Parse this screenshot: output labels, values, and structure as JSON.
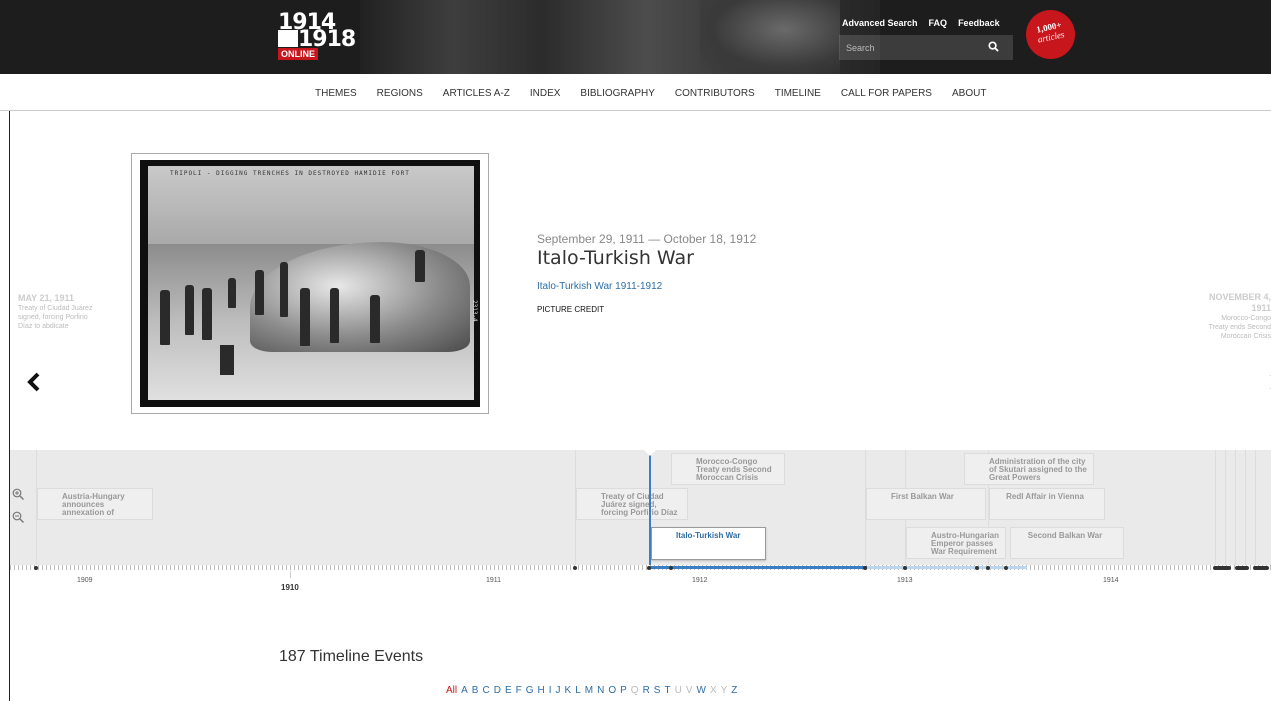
{
  "header": {
    "logo": {
      "year_top": "1914",
      "year_bottom": "1918",
      "online": "ONLINE"
    },
    "utility_links": [
      "Advanced Search",
      "FAQ",
      "Feedback"
    ],
    "search": {
      "placeholder": "Search",
      "value": ""
    },
    "badge": {
      "number": "1,000+",
      "text": "articles"
    }
  },
  "nav": [
    "THEMES",
    "REGIONS",
    "ARTICLES A-Z",
    "INDEX",
    "BIBLIOGRAPHY",
    "CONTRIBUTORS",
    "TIMELINE",
    "CALL FOR PAPERS",
    "ABOUT"
  ],
  "slide": {
    "image_caption": "TRIPOLI - DIGGING TRENCHES IN DESTROYED HAMIDIE FORT",
    "image_number": "2313-4",
    "date_range": "September 29, 1911 — October 18, 1912",
    "title": "Italo-Turkish War",
    "link": "Italo-Turkish War 1911-1912",
    "credit": "PICTURE CREDIT"
  },
  "prev": {
    "date": "MAY 21, 1911",
    "text": "Treaty of Ciudad Juárez signed, forcing Porfirio Díaz to abdicate"
  },
  "next": {
    "date": "NOVEMBER 4, 1911",
    "text": "Morocco-Congo Treaty ends Second Moroccan Crisis"
  },
  "timeline": {
    "cards": [
      {
        "label": "Austria-Hungary announces annexation of"
      },
      {
        "label": "Treaty of Ciudad Juárez signed, forcing Porfirio Díaz"
      },
      {
        "label": "Morocco-Congo Treaty ends Second Moroccan Crisis"
      },
      {
        "label": "Italo-Turkish War"
      },
      {
        "label": "First Balkan War"
      },
      {
        "label": "Administration of the city of Skutari assigned to the Great Powers"
      },
      {
        "label": "Redl Affair in Vienna"
      },
      {
        "label": "Austro-Hungarian Emperor passes War Requirement"
      },
      {
        "label": "Second Balkan War"
      }
    ],
    "years": [
      "1909",
      "1910",
      "1911",
      "1912",
      "1913",
      "1914"
    ]
  },
  "footer": {
    "count": "187 Timeline Events",
    "letters": [
      "All",
      "A",
      "B",
      "C",
      "D",
      "E",
      "F",
      "G",
      "H",
      "I",
      "J",
      "K",
      "L",
      "M",
      "N",
      "O",
      "P",
      "Q",
      "R",
      "S",
      "T",
      "U",
      "V",
      "W",
      "X",
      "Y",
      "Z"
    ],
    "disabled_letters": [
      "Q",
      "U",
      "V",
      "X",
      "Y"
    ],
    "current_letter": "All"
  },
  "colors": {
    "brand_red": "#c8161d",
    "link_blue": "#2e6da4",
    "timeline_blue": "#3a7fc4"
  }
}
